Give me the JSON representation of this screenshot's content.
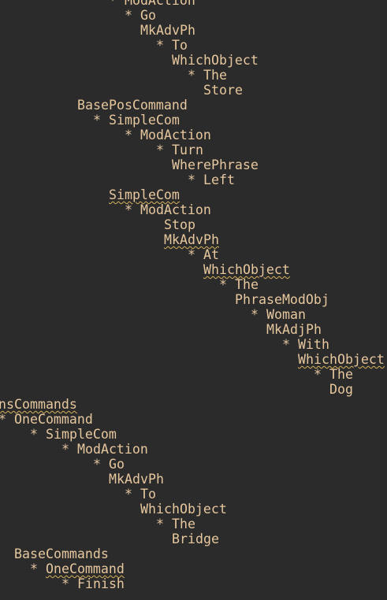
{
  "editor": {
    "lines": [
      {
        "text": "  * ModAction",
        "col": 12,
        "squiggle": false
      },
      {
        "text": "* Go",
        "col": 16,
        "squiggle": false
      },
      {
        "text": "MkAdvPh",
        "col": 18,
        "squiggle": false
      },
      {
        "text": "* To",
        "col": 20,
        "squiggle": false
      },
      {
        "text": "WhichObject",
        "col": 22,
        "squiggle": false
      },
      {
        "text": "* The",
        "col": 24,
        "squiggle": false
      },
      {
        "text": "Store",
        "col": 26,
        "squiggle": false
      },
      {
        "text": "BasePosCommand",
        "col": 10,
        "squiggle": false
      },
      {
        "text": "* SimpleCom",
        "col": 12,
        "squiggle": false
      },
      {
        "text": "* ModAction",
        "col": 16,
        "squiggle": false
      },
      {
        "text": "* Turn",
        "col": 20,
        "squiggle": false
      },
      {
        "text": "WherePhrase",
        "col": 22,
        "squiggle": false
      },
      {
        "text": "* Left",
        "col": 24,
        "squiggle": false
      },
      {
        "text": "SimpleCom",
        "col": 14,
        "squiggle": true
      },
      {
        "text": "* ModAction",
        "col": 16,
        "squiggle": false
      },
      {
        "text": "Stop",
        "col": 21,
        "squiggle": false
      },
      {
        "text": "MkAdvPh",
        "col": 21,
        "squiggle": true
      },
      {
        "text": "* At",
        "col": 24,
        "squiggle": false
      },
      {
        "text": "WhichObject",
        "col": 26,
        "squiggle": true
      },
      {
        "text": "* The",
        "col": 28,
        "squiggle": false
      },
      {
        "text": "PhraseModObj",
        "col": 30,
        "squiggle": false
      },
      {
        "text": "* Woman",
        "col": 32,
        "squiggle": false
      },
      {
        "text": "MkAdjPh",
        "col": 34,
        "squiggle": false
      },
      {
        "text": "* With",
        "col": 36,
        "squiggle": false
      },
      {
        "text": "WhichObject",
        "col": 38,
        "squiggle": true
      },
      {
        "text": "* The",
        "col": 40,
        "squiggle": false
      },
      {
        "text": "Dog",
        "col": 42,
        "squiggle": false
      },
      {
        "text": "nsCommands",
        "col": 0,
        "squiggle": true
      },
      {
        "text": "* OneCommand",
        "col": 0,
        "squiggle": false
      },
      {
        "text": "* SimpleCom",
        "col": 4,
        "squiggle": false
      },
      {
        "text": "* ModAction",
        "col": 8,
        "squiggle": false
      },
      {
        "text": "* Go",
        "col": 12,
        "squiggle": false
      },
      {
        "text": "MkAdvPh",
        "col": 14,
        "squiggle": false
      },
      {
        "text": "* To",
        "col": 16,
        "squiggle": false
      },
      {
        "text": "WhichObject",
        "col": 18,
        "squiggle": false
      },
      {
        "text": "* The",
        "col": 20,
        "squiggle": false
      },
      {
        "text": "Bridge",
        "col": 22,
        "squiggle": false
      },
      {
        "text": "BaseCommands",
        "col": 2,
        "squiggle": false
      },
      {
        "text": "* OneCommand",
        "col": 4,
        "squiggle": false,
        "squiggle_word": "OneCommand"
      },
      {
        "text": "* Finish",
        "col": 8,
        "squiggle": false
      }
    ]
  },
  "colors": {
    "background": "#2b2b2b",
    "text": "#e7c79e",
    "squiggle": "#d7b25b"
  }
}
